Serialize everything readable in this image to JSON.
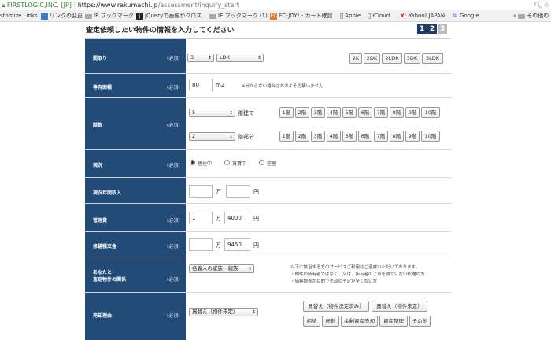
{
  "browser": {
    "secure_label": "FIRSTLOGIC,INC. [JP]",
    "url_host": "https://www.rakumachi.jp",
    "url_path": "/assessment/inquiry_start",
    "bookmarks": [
      {
        "label": "stomize Links"
      },
      {
        "label": "リンクの変更"
      },
      {
        "label": "IE ブックマーク"
      },
      {
        "label": "jQueryで画像がクロス..."
      },
      {
        "label": "IE ブックマーク (1)"
      },
      {
        "label": "EC-JOY! - カート確認"
      },
      {
        "label": "Apple"
      },
      {
        "label": "iCloud"
      },
      {
        "label": "Yahoo! JAPAN"
      },
      {
        "label": "Google"
      },
      {
        "label": "その他の"
      }
    ]
  },
  "page": {
    "heading": "査定依頼したい物件の情報を入力してください",
    "steps": [
      "1",
      "2",
      "3"
    ]
  },
  "required_label": "(必須)",
  "rows": {
    "layout": {
      "label": "間取り",
      "rooms_value": "3",
      "type_value": "LDK",
      "options": [
        "2K",
        "2DK",
        "2LDK",
        "3DK",
        "3LDK"
      ]
    },
    "area": {
      "label": "専有面積",
      "value": "80",
      "unit": "m2",
      "note": "※分からない場合はおおよそで構いません"
    },
    "floors": {
      "label": "階数",
      "building_value": "5",
      "building_suffix": "階建て",
      "unit_value": "2",
      "unit_suffix": "階部分",
      "options": [
        "1階",
        "2階",
        "3階",
        "4階",
        "5階",
        "6階",
        "7階",
        "8階",
        "9階",
        "10階"
      ]
    },
    "status": {
      "label": "現況",
      "options": [
        "居住中",
        "賃貸中",
        "空室"
      ]
    },
    "income": {
      "label": "現況年間収入",
      "man_value": "",
      "man_unit": "万",
      "yen_value": "",
      "yen_unit": "円"
    },
    "management": {
      "label": "管理費",
      "man_value": "1",
      "man_unit": "万",
      "yen_value": "4000",
      "yen_unit": "円"
    },
    "repair": {
      "label": "修繕積立金",
      "man_value": "",
      "man_unit": "万",
      "yen_value": "9450",
      "yen_unit": "円"
    },
    "relation": {
      "label_line1": "あなたと",
      "label_line2": "査定物件の関係",
      "select_value": "名義人の家族・親族",
      "note_line1": "以下に該当する方のサービスご利用はご遠慮いただいております。",
      "note_line2": "・物件の所有者ではなく、又は、所有者の了承を得ていない代理の方",
      "note_line3": "・価格調査が目的で売却の予定が全くない方"
    },
    "reason": {
      "label": "売却理由",
      "select_value": "買替え（物件未定）",
      "options_row1": [
        "買替え（物件決定済み）",
        "買替え（物件未定）"
      ],
      "options_row2": [
        "相続",
        "転勤",
        "余剰資産売却",
        "資産整理",
        "その他"
      ]
    }
  },
  "colors": {
    "label_bg": "#234b78",
    "step_active": "#1d3b66",
    "step_inactive": "#bbbbbb"
  }
}
